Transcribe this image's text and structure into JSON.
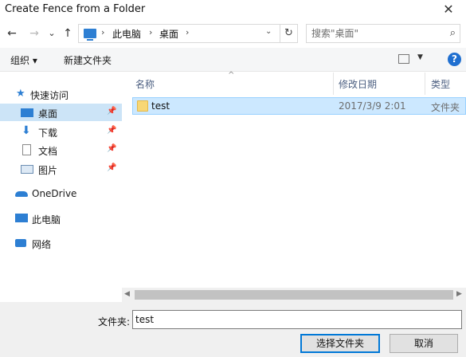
{
  "window": {
    "title": "Create Fence from a Folder",
    "close_glyph": "✕"
  },
  "nav": {
    "back": "←",
    "forward": "→",
    "recent": "⌄",
    "up": "↑"
  },
  "address": {
    "crumbs": [
      "此电脑",
      "桌面"
    ],
    "sep": "›",
    "dropdown": "⌄",
    "refresh": "↻"
  },
  "search": {
    "placeholder": "搜索\"桌面\"",
    "icon": "⌕"
  },
  "toolbar": {
    "organize": "组织 ▾",
    "new_folder": "新建文件夹",
    "view_dd": "▼",
    "help": "?"
  },
  "sidebar": {
    "pin": "📌",
    "items": [
      {
        "label": "快速访问"
      },
      {
        "label": "桌面"
      },
      {
        "label": "下载"
      },
      {
        "label": "文档"
      },
      {
        "label": "图片"
      },
      {
        "label": "OneDrive"
      },
      {
        "label": "此电脑"
      },
      {
        "label": "网络"
      }
    ]
  },
  "columns": {
    "name": "名称",
    "date": "修改日期",
    "type": "类型",
    "sort_arrow": "^"
  },
  "files": [
    {
      "name": "test",
      "date": "2017/3/9 2:01",
      "type": "文件夹"
    }
  ],
  "scroll": {
    "left": "◀",
    "right": "▶"
  },
  "bottom": {
    "folder_label": "文件夹:",
    "folder_value": "test",
    "select_button": "选择文件夹",
    "cancel_button": "取消"
  },
  "colors": {
    "selection": "#cce8ff",
    "accent": "#0078d7",
    "nav_selected": "#cce4f7"
  }
}
